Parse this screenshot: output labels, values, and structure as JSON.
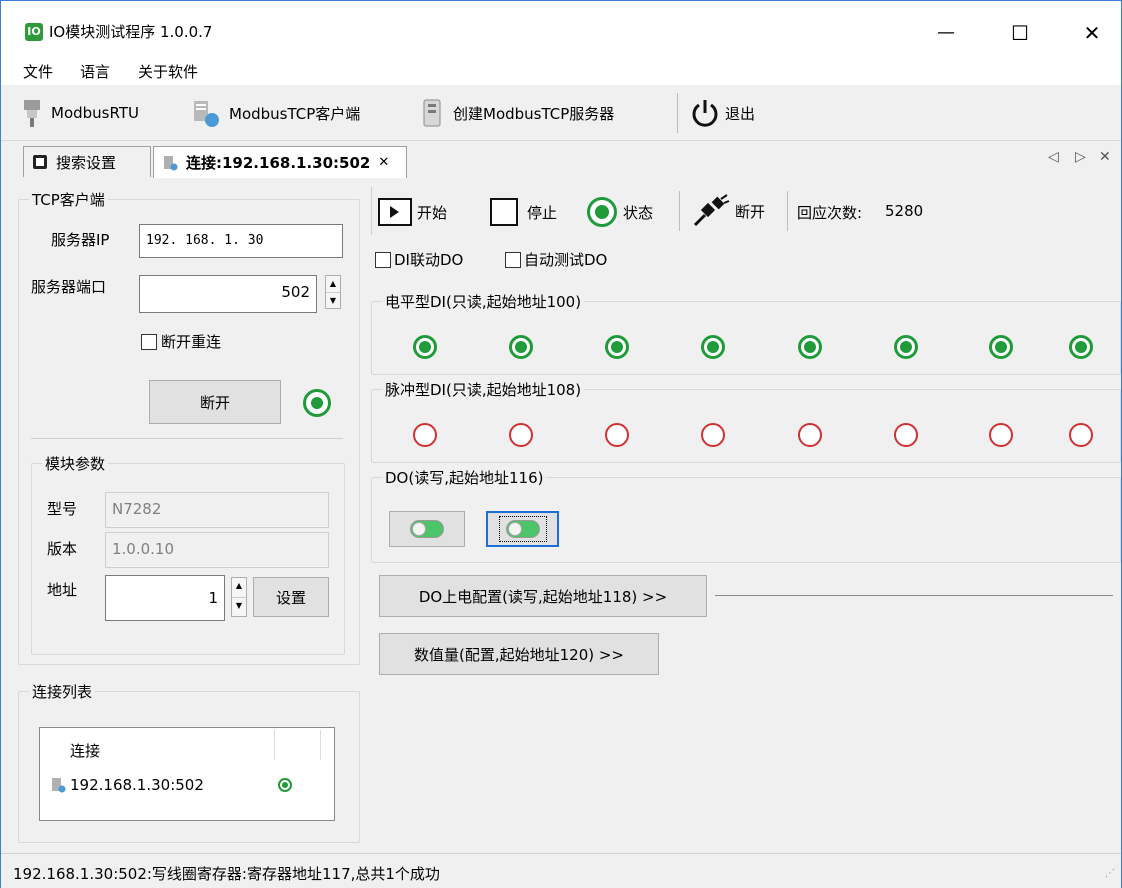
{
  "window": {
    "title": "IO模块测试程序 1.0.0.7",
    "app_icon": "io-app-icon",
    "minimize": "—",
    "maximize": "☐",
    "close": "✕"
  },
  "menu": [
    "文件",
    "语言",
    "关于软件"
  ],
  "toolbar": {
    "rtu": "ModbusRTU",
    "tcp_client": "ModbusTCP客户端",
    "tcp_server": "创建ModbusTCP服务器",
    "exit": "退出"
  },
  "tabs": [
    {
      "label": "搜索设置"
    },
    {
      "label": "连接:192.168.1.30:502",
      "close": "✕"
    }
  ],
  "tab_controls": {
    "prev": "◁",
    "next": "▷",
    "close": "✕"
  },
  "tcp_client": {
    "title": "TCP客户端",
    "server_ip_label": "服务器IP",
    "server_ip": "192. 168.   1.  30",
    "server_port_label": "服务器端口",
    "server_port": "502",
    "reconnect_label": "断开重连",
    "disconnect_button": "断开",
    "status": "connected"
  },
  "module_params": {
    "title": "模块参数",
    "model_label": "型号",
    "model": "N7282",
    "version_label": "版本",
    "version": "1.0.0.10",
    "address_label": "地址",
    "address": "1",
    "set_button": "设置"
  },
  "connections": {
    "title": "连接列表",
    "column": "连接",
    "items": [
      {
        "name": "192.168.1.30:502",
        "status": "connected"
      }
    ]
  },
  "controls": {
    "start": "开始",
    "stop": "停止",
    "status": "状态",
    "disconnect": "断开",
    "response_count_label": "回应次数:",
    "response_count": "5280",
    "di_link_do": "DI联动DO",
    "auto_test_do": "自动测试DO"
  },
  "di_level": {
    "title": "电平型DI(只读,起始地址100)",
    "states": [
      true,
      true,
      true,
      true,
      true,
      true,
      true,
      true
    ]
  },
  "di_pulse": {
    "title": "脉冲型DI(只读,起始地址108)",
    "states": [
      false,
      false,
      false,
      false,
      false,
      false,
      false,
      false
    ]
  },
  "do": {
    "title": "DO(读写,起始地址116)",
    "states": [
      true,
      true
    ]
  },
  "do_power_button": "DO上电配置(读写,起始地址118) >>",
  "numeric_button": "数值量(配置,起始地址120) >>",
  "status_bar": "192.168.1.30:502:写线圈寄存器:寄存器地址117,总共1个成功",
  "colors": {
    "led_on": "#1f9b3a",
    "led_off": "#d23030",
    "accent": "#3c7fd9"
  }
}
